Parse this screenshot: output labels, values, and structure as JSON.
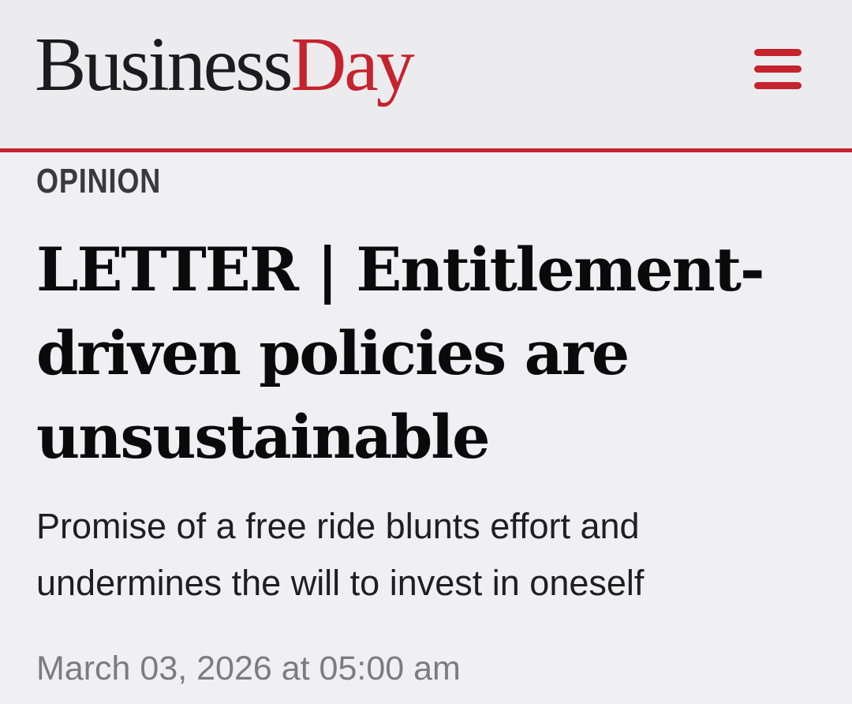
{
  "header": {
    "logo_part1": "Business",
    "logo_part2": "Day",
    "menu_icon": "hamburger-menu-icon"
  },
  "article": {
    "section": "OPINION",
    "headline": "LETTER | Entitlement-driven policies are unsustainable",
    "standfirst": "Promise of a free ride blunts effort and undermines the will to invest in oneself",
    "timestamp": "March 03, 2026 at 05:00 am"
  },
  "colors": {
    "brand_red": "#c5232d",
    "background": "#efeff4",
    "header_background": "#ececee",
    "text_dark": "#0a0a0a",
    "text_muted": "#7b7b80"
  }
}
